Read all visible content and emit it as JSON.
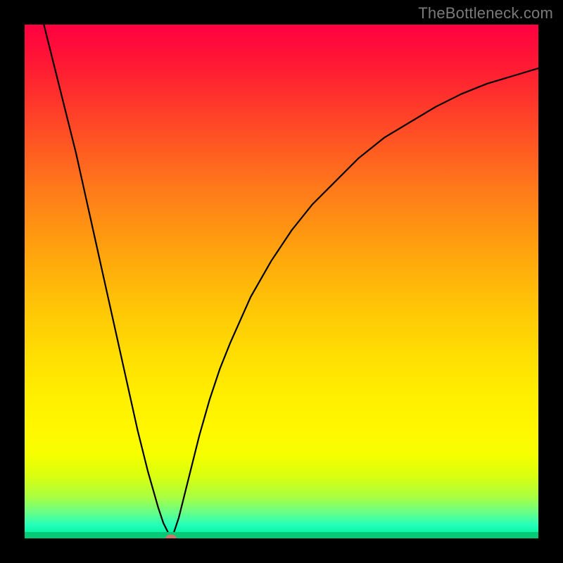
{
  "watermark": "TheBottleneck.com",
  "colors": {
    "frame": "#000000",
    "marker": "#c87868",
    "green_bar": "#04c977",
    "curve": "#000000"
  },
  "chart_data": {
    "type": "line",
    "title": "",
    "xlabel": "",
    "ylabel": "",
    "xlim": [
      0,
      100
    ],
    "ylim": [
      0,
      100
    ],
    "x": [
      0,
      2,
      4,
      6,
      8,
      10,
      12,
      14,
      16,
      18,
      20,
      22,
      24,
      26,
      27,
      28,
      28.5,
      29,
      30,
      31,
      32,
      33,
      34,
      36,
      38,
      40,
      44,
      48,
      52,
      56,
      60,
      65,
      70,
      75,
      80,
      85,
      90,
      95,
      100
    ],
    "y": [
      115,
      107,
      99,
      91,
      83,
      75,
      66,
      57,
      48,
      39,
      30,
      21,
      13,
      6,
      3,
      1,
      0,
      1,
      4,
      8,
      12,
      16,
      20,
      27,
      33,
      38,
      47,
      54,
      60,
      65,
      69,
      74,
      78,
      81,
      84,
      86.5,
      88.5,
      90,
      91.5
    ],
    "marker": {
      "x": 28.5,
      "y": 0
    },
    "green_bar_y": 0
  }
}
